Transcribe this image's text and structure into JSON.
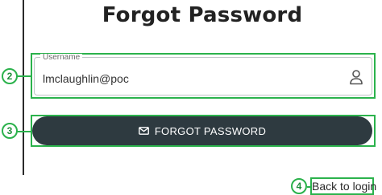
{
  "page": {
    "title": "Forgot Password"
  },
  "form": {
    "username_label": "Username",
    "username_value": "lmclaughlin@poc",
    "submit_label": "FORGOT PASSWORD",
    "back_link": "Back to login"
  },
  "annotations": {
    "markers": [
      "2",
      "3",
      "4"
    ]
  },
  "icons": {
    "user": "user-icon",
    "mail": "mail-icon"
  },
  "colors": {
    "annotation": "#2bb24c",
    "button_bg": "#2e3a40"
  }
}
